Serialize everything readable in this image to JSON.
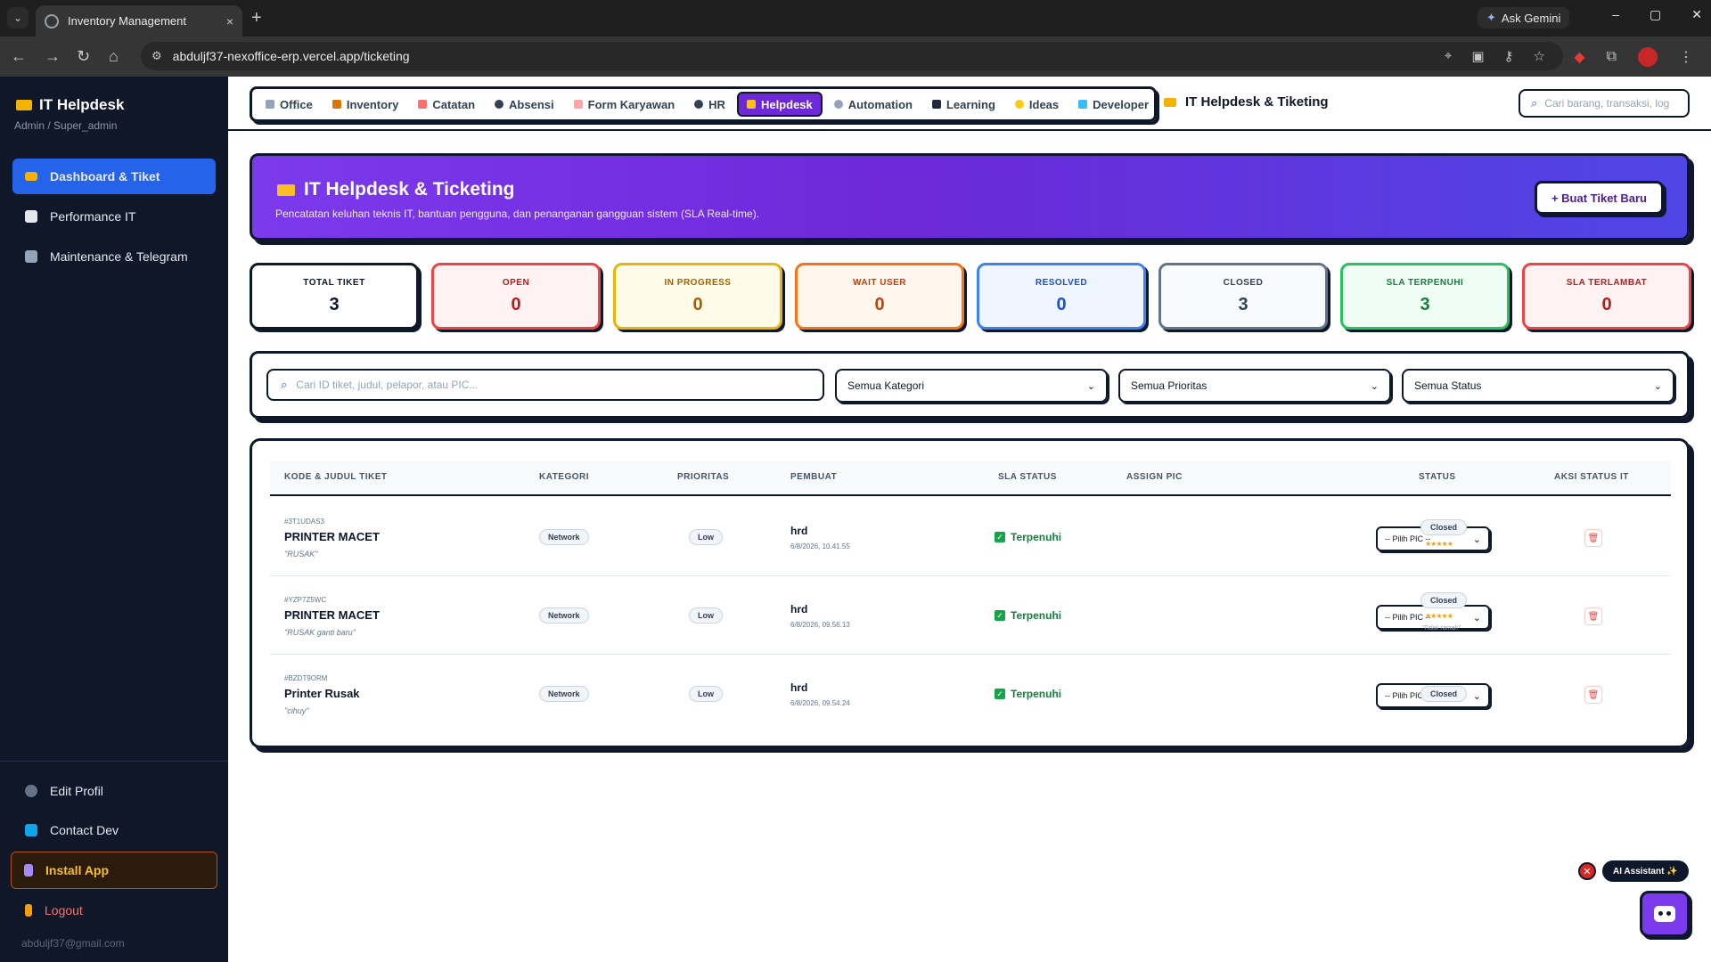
{
  "browser": {
    "tab_title": "Inventory Management",
    "tab_close": "×",
    "new_tab": "+",
    "ask_gemini": "Ask Gemini",
    "url": "abduljf37-nexoffice-erp.vercel.app/ticketing",
    "win_min": "–",
    "win_max": "▢",
    "win_close": "✕"
  },
  "sidebar": {
    "brand": "IT Helpdesk",
    "role": "Admin / Super_admin",
    "items": [
      {
        "label": "Dashboard & Tiket",
        "active": true
      },
      {
        "label": "Performance IT"
      },
      {
        "label": "Maintenance & Telegram"
      }
    ],
    "bottom": [
      {
        "label": "Edit Profil"
      },
      {
        "label": "Contact Dev"
      },
      {
        "label": "Install App"
      },
      {
        "label": "Logout"
      }
    ],
    "email": "abduljf37@gmail.com"
  },
  "topnav": {
    "items": [
      {
        "label": "Office"
      },
      {
        "label": "Inventory"
      },
      {
        "label": "Catatan"
      },
      {
        "label": "Absensi"
      },
      {
        "label": "Form Karyawan"
      },
      {
        "label": "HR"
      },
      {
        "label": "Helpdesk",
        "active": true
      },
      {
        "label": "Automation"
      },
      {
        "label": "Learning"
      },
      {
        "label": "Ideas"
      },
      {
        "label": "Developer"
      }
    ],
    "page_heading": "IT Helpdesk & Tiketing",
    "search_placeholder": "Cari barang, transaksi, log"
  },
  "hero": {
    "title": "IT Helpdesk & Ticketing",
    "subtitle": "Pencatatan keluhan teknis IT, bantuan pengguna, dan penanganan gangguan sistem (SLA Real-time).",
    "new_ticket_button": "+ Buat Tiket Baru"
  },
  "stats": [
    {
      "label": "TOTAL TIKET",
      "value": "3",
      "color": "#0f172a",
      "border": "#0f172a",
      "bg": "#ffffff"
    },
    {
      "label": "OPEN",
      "value": "0",
      "color": "#b91c1c",
      "border": "#ef4444",
      "bg": "#fef2f2"
    },
    {
      "label": "IN PROGRESS",
      "value": "0",
      "color": "#a16207",
      "border": "#eab308",
      "bg": "#fefce8"
    },
    {
      "label": "WAIT USER",
      "value": "0",
      "color": "#c2410c",
      "border": "#f97316",
      "bg": "#fff7ed"
    },
    {
      "label": "RESOLVED",
      "value": "0",
      "color": "#1d4ed8",
      "border": "#3b82f6",
      "bg": "#eff6ff"
    },
    {
      "label": "CLOSED",
      "value": "3",
      "color": "#334155",
      "border": "#64748b",
      "bg": "#f8fafc"
    },
    {
      "label": "SLA TERPENUHI",
      "value": "3",
      "color": "#15803d",
      "border": "#22c55e",
      "bg": "#f0fdf4"
    },
    {
      "label": "SLA TERLAMBAT",
      "value": "0",
      "color": "#b91c1c",
      "border": "#ef4444",
      "bg": "#fef2f2"
    }
  ],
  "filters": {
    "search_placeholder": "Cari ID tiket, judul, pelapor, atau PIC...",
    "category": "Semua Kategori",
    "priority": "Semua Prioritas",
    "status": "Semua Status"
  },
  "table": {
    "headers": [
      "KODE & JUDUL TIKET",
      "KATEGORI",
      "PRIORITAS",
      "PEMBUAT",
      "SLA STATUS",
      "ASSIGN PIC",
      "STATUS",
      "AKSI STATUS IT"
    ],
    "rows": [
      {
        "code": "#3T1UDAS3",
        "title": "PRINTER MACET",
        "desc": "\"RUSAK\"",
        "category": "Network",
        "priority": "Low",
        "creator": "hrd",
        "date": "6/8/2026, 10.41.55",
        "sla": "Terpenuhi",
        "pic": "-- Pilih PIC --",
        "status": "Closed",
        "rating": "★★★★★",
        "feedback": ""
      },
      {
        "code": "#YZP7Z5WC",
        "title": "PRINTER MACET",
        "desc": "\"RUSAK ganti baru\"",
        "category": "Network",
        "priority": "Low",
        "creator": "hrd",
        "date": "6/8/2026, 09.56.13",
        "sla": "Terpenuhi",
        "pic": "-- Pilih PIC --",
        "status": "Closed",
        "rating": "★★★★★",
        "feedback": "\"Tidak ramah\""
      },
      {
        "code": "#BZDT9ORM",
        "title": "Printer Rusak",
        "desc": "\"cihuy\"",
        "category": "Network",
        "priority": "Low",
        "creator": "hrd",
        "date": "6/8/2026, 09.54.24",
        "sla": "Terpenuhi",
        "pic": "-- Pilih PIC --",
        "status": "Closed",
        "rating": "",
        "feedback": ""
      }
    ]
  },
  "ai": {
    "label": "AI Assistant ✨",
    "close": "✕"
  }
}
